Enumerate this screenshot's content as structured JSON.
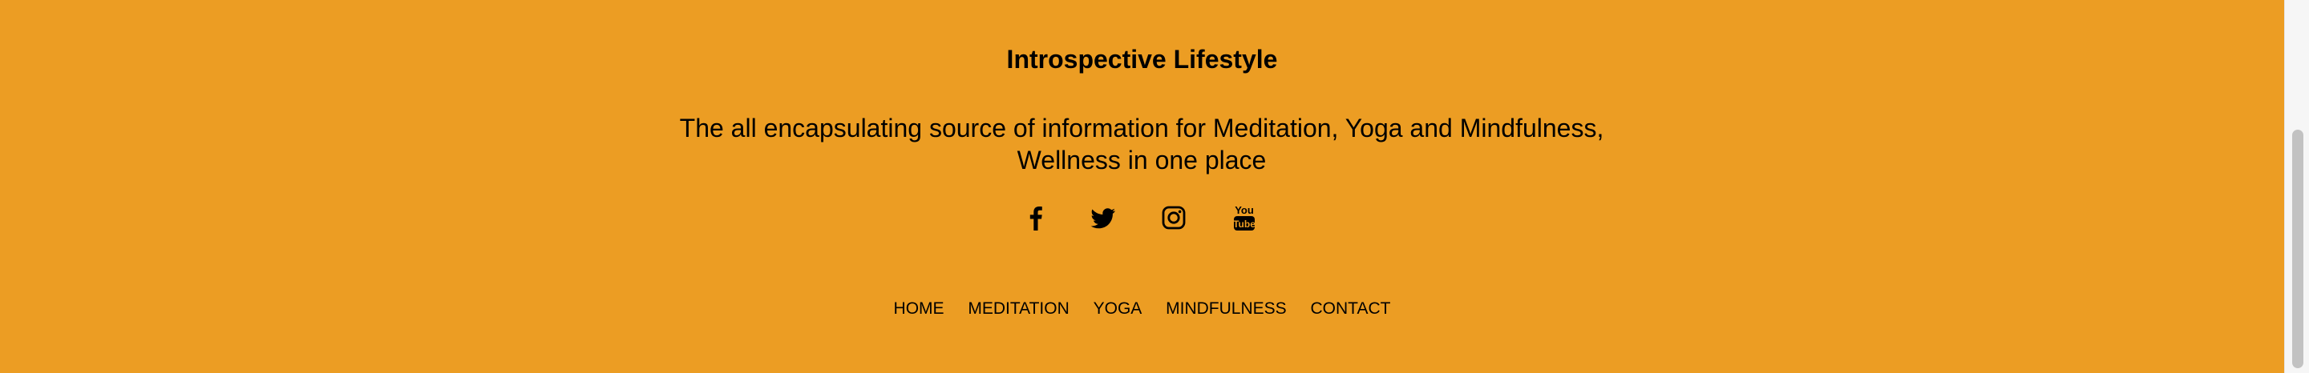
{
  "footer": {
    "background": "#EC9D23",
    "brand": "Introspective Lifestyle",
    "tagline": "The all encapsulating source of information for Meditation, Yoga and Mindfulness, Wellness in one place",
    "social": [
      {
        "icon": "facebook-icon"
      },
      {
        "icon": "twitter-icon"
      },
      {
        "icon": "instagram-icon"
      },
      {
        "icon": "youtube-icon"
      }
    ],
    "nav": [
      "HOME",
      "MEDITATION",
      "YOGA",
      "MINDFULNESS",
      "CONTACT"
    ]
  }
}
